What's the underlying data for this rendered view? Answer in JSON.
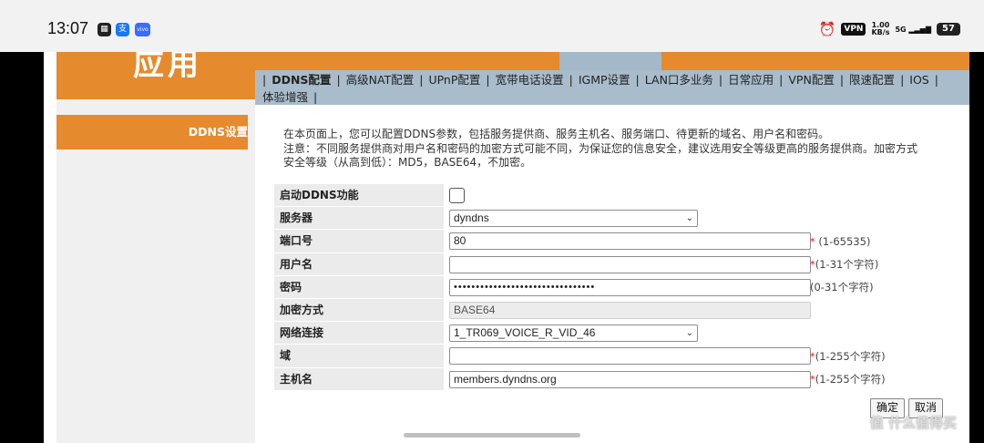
{
  "statusbar": {
    "time": "13:07",
    "vpn": "VPN",
    "speed_value": "1.00",
    "speed_unit": "KB/s",
    "network": "5G",
    "battery": "57"
  },
  "header": {
    "logo_text": "应用"
  },
  "nav": {
    "items": [
      {
        "label": "DDNS配置",
        "active": true
      },
      {
        "label": "高级NAT配置"
      },
      {
        "label": "UPnP配置"
      },
      {
        "label": "宽带电话设置"
      },
      {
        "label": "IGMP设置"
      },
      {
        "label": "LAN口多业务"
      },
      {
        "label": "日常应用"
      },
      {
        "label": "VPN配置"
      },
      {
        "label": "限速配置"
      },
      {
        "label": "IOS"
      },
      {
        "label": "体验增强"
      }
    ],
    "separator": "|"
  },
  "left_menu": {
    "ddns": "DDNS设置"
  },
  "description": {
    "line1": "在本页面上，您可以配置DDNS参数，包括服务提供商、服务主机名、服务端口、待更新的域名、用户名和密码。",
    "line2": "注意：不同服务提供商对用户名和密码的加密方式可能不同，为保证您的信息安全，建议选用安全等级更高的服务提供商。加密方式",
    "line3": "安全等级（从高到低）：MD5，BASE64，不加密。"
  },
  "form": {
    "enable_label": "启动DDNS功能",
    "server_label": "服务器",
    "server_value": "dyndns",
    "port_label": "端口号",
    "port_value": "80",
    "port_hint": "(1-65535)",
    "username_label": "用户名",
    "username_value": "",
    "username_hint": "(1-31个字符)",
    "password_label": "密码",
    "password_value": "••••••••••••••••••••••••••••••••",
    "password_hint": "(0-31个字符)",
    "encrypt_label": "加密方式",
    "encrypt_value": "BASE64",
    "network_label": "网络连接",
    "network_value": "1_TR069_VOICE_R_VID_46",
    "domain_label": "域",
    "domain_value": "",
    "domain_hint": "(1-255个字符)",
    "hostname_label": "主机名",
    "hostname_value": "members.dyndns.org",
    "hostname_hint": "(1-255个字符)",
    "required_mark": "*"
  },
  "buttons": {
    "confirm": "确定",
    "cancel": "取消"
  },
  "watermark": "值 什么值得买"
}
